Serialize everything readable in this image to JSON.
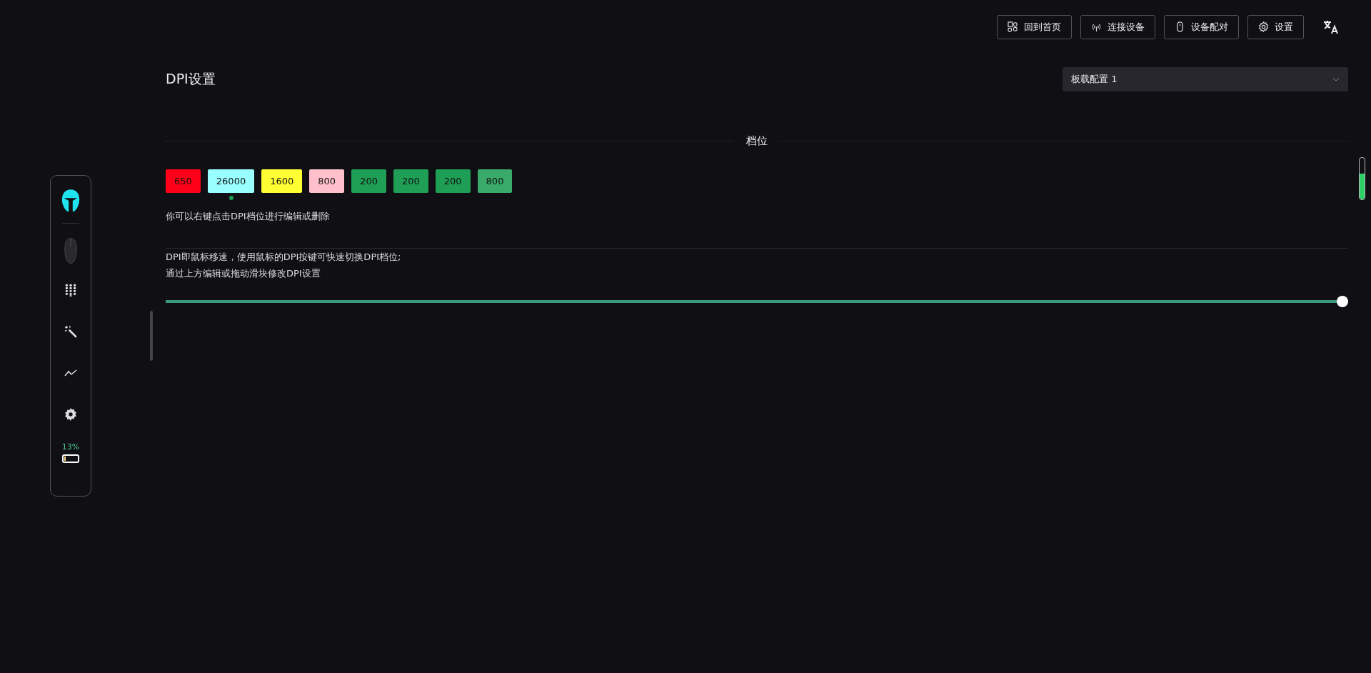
{
  "top_buttons": [
    {
      "kind": "home",
      "label": "回到首页"
    },
    {
      "kind": "signal",
      "label": "连接设备"
    },
    {
      "kind": "mouse",
      "label": "设备配对"
    },
    {
      "kind": "gear",
      "label": "设置"
    }
  ],
  "page_title": "DPI设置",
  "profile_select": {
    "value": "板载配置 1"
  },
  "section_title": "档位",
  "dpi_levels": [
    {
      "label": "650",
      "color": "#ff0019",
      "selected": false
    },
    {
      "label": "26000",
      "color": "#99ffff",
      "selected": true
    },
    {
      "label": "1600",
      "color": "#ffff33",
      "selected": false
    },
    {
      "label": "800",
      "color": "#ffc0cb",
      "selected": false
    },
    {
      "label": "200",
      "color": "#1f9e55",
      "selected": false
    },
    {
      "label": "200",
      "color": "#1f9e55",
      "selected": false
    },
    {
      "label": "200",
      "color": "#1f9e55",
      "selected": false
    },
    {
      "label": "800",
      "color": "#3aaa6a",
      "selected": false
    }
  ],
  "hint": "你可以右键点击DPI档位进行编辑或删除",
  "description": [
    "DPI即鼠标移速，使用鼠标的DPI按键可快速切换DPI档位;",
    "通过上方编辑或拖动滑块修改DPI设置"
  ],
  "dpi_slider": {
    "level": 1
  },
  "side_indicator": {
    "level": 0.62
  },
  "sidebar": {
    "items": [
      {
        "kind": "mouse"
      },
      {
        "kind": "keypad"
      },
      {
        "kind": "wand"
      },
      {
        "kind": "chart"
      },
      {
        "kind": "gear"
      }
    ],
    "battery_text": "13%",
    "battery": {
      "level": 0.13
    }
  }
}
